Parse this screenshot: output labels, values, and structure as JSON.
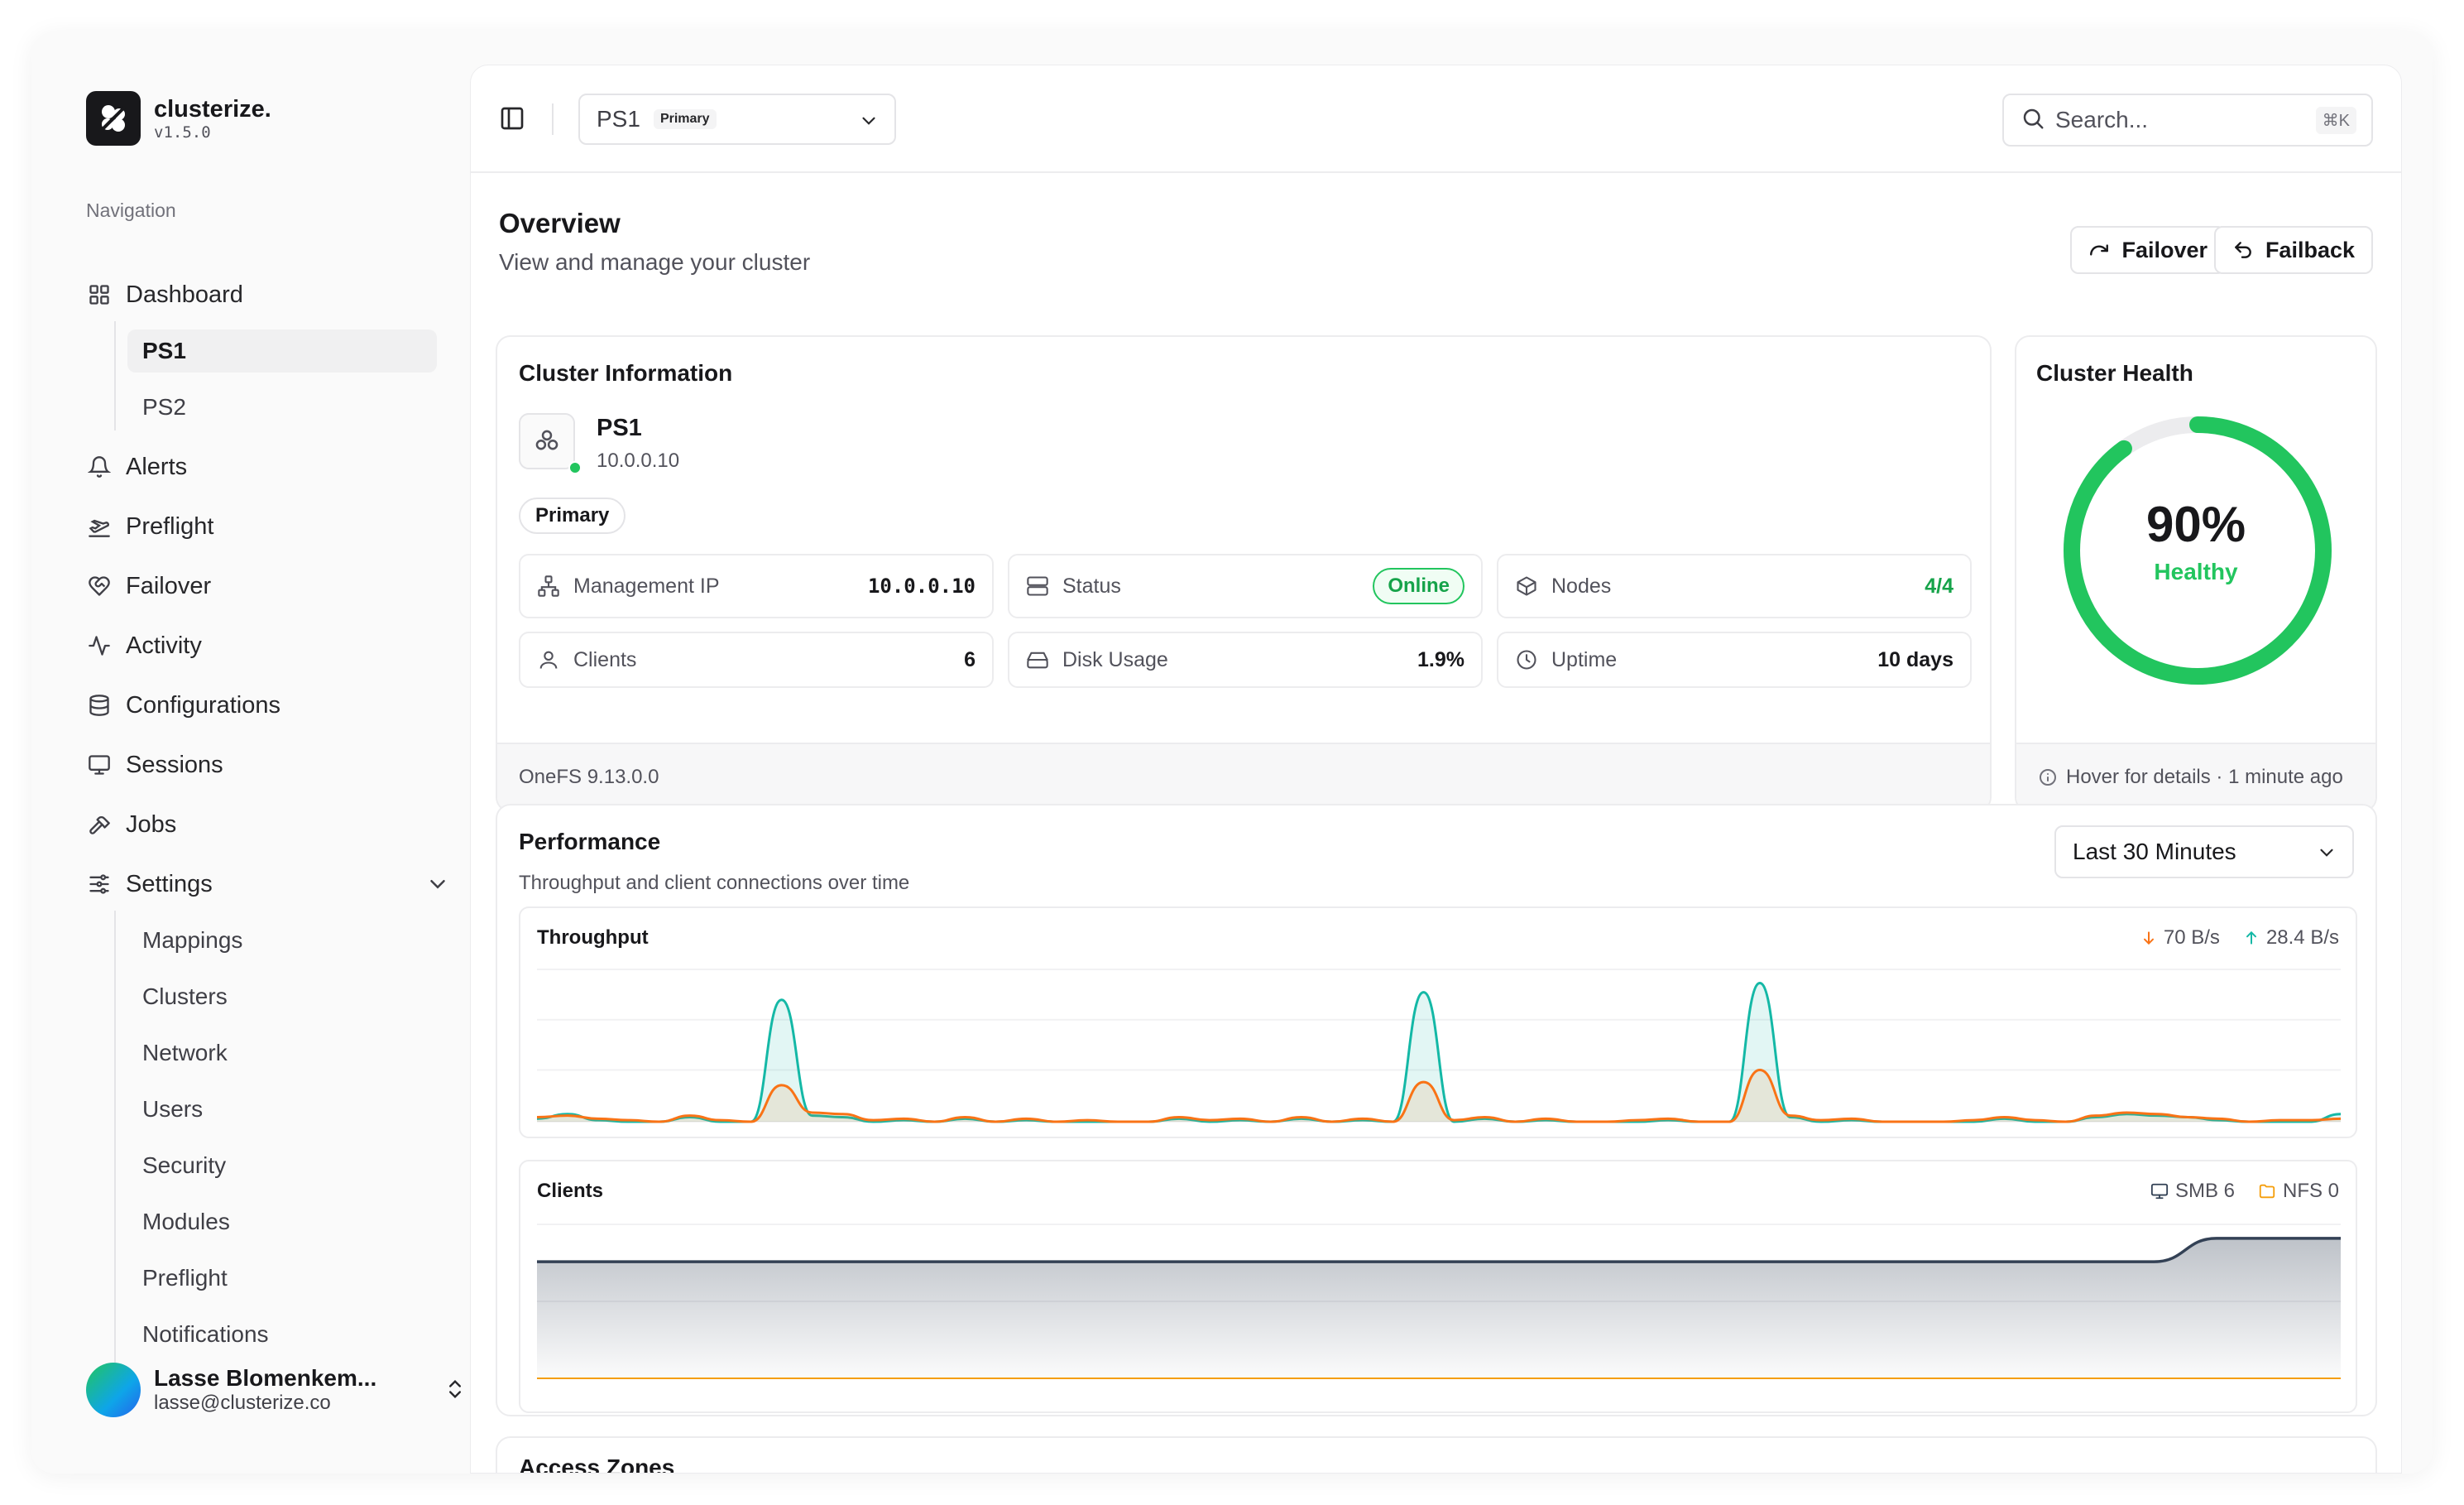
{
  "brand": {
    "name": "clusterize.",
    "version": "v1.5.0"
  },
  "sidebar": {
    "heading": "Navigation",
    "items": [
      {
        "label": "Dashboard",
        "icon": "layout-grid-icon"
      },
      {
        "label": "Alerts",
        "icon": "bell-icon"
      },
      {
        "label": "Preflight",
        "icon": "plane-takeoff-icon"
      },
      {
        "label": "Failover",
        "icon": "heart-handshake-icon"
      },
      {
        "label": "Activity",
        "icon": "activity-icon"
      },
      {
        "label": "Configurations",
        "icon": "database-icon"
      },
      {
        "label": "Sessions",
        "icon": "monitor-icon"
      },
      {
        "label": "Jobs",
        "icon": "hammer-icon"
      },
      {
        "label": "Settings",
        "icon": "sliders-icon"
      }
    ],
    "dashboard_children": [
      "PS1",
      "PS2"
    ],
    "settings_children": [
      "Mappings",
      "Clusters",
      "Network",
      "Users",
      "Security",
      "Modules",
      "Preflight",
      "Notifications"
    ]
  },
  "user": {
    "name": "Lasse Blomenkem...",
    "email": "lasse@clusterize.co"
  },
  "header": {
    "cluster_name": "PS1",
    "cluster_badge": "Primary",
    "search_placeholder": "Search...",
    "search_shortcut": "⌘K"
  },
  "overview": {
    "title": "Overview",
    "subtitle": "View and manage your cluster",
    "failover_label": "Failover",
    "failback_label": "Failback"
  },
  "cluster_info": {
    "title": "Cluster Information",
    "name": "PS1",
    "ip": "10.0.0.10",
    "role": "Primary",
    "stats": {
      "management_ip": {
        "label": "Management IP",
        "value": "10.0.0.10"
      },
      "status": {
        "label": "Status",
        "value": "Online"
      },
      "nodes": {
        "label": "Nodes",
        "value": "4/4"
      },
      "clients": {
        "label": "Clients",
        "value": "6"
      },
      "disk_usage": {
        "label": "Disk Usage",
        "value": "1.9%"
      },
      "uptime": {
        "label": "Uptime",
        "value": "10 days"
      }
    },
    "footer": "OneFS 9.13.0.0"
  },
  "cluster_health": {
    "title": "Cluster Health",
    "percent": 90,
    "percent_label": "90%",
    "status": "Healthy",
    "footer": "Hover for details · 1 minute ago",
    "color": "#22c55e"
  },
  "performance": {
    "title": "Performance",
    "subtitle": "Throughput and client connections over time",
    "range": "Last 30 Minutes",
    "throughput": {
      "title": "Throughput",
      "down_label": "70 B/s",
      "up_label": "28.4 B/s",
      "down_color": "#f97316",
      "up_color": "#14b8a6"
    },
    "clients": {
      "title": "Clients",
      "smb_label": "SMB 6",
      "nfs_label": "NFS 0",
      "smb_color": "#334155",
      "nfs_color": "#f59e0b"
    }
  },
  "chart_data": [
    {
      "type": "area",
      "title": "Throughput",
      "x": [
        0,
        1,
        2,
        3,
        4,
        5,
        6,
        7,
        8,
        9,
        10,
        11,
        12,
        13,
        14,
        15,
        16,
        17,
        18,
        19,
        20,
        21,
        22,
        23,
        24,
        25,
        26,
        27,
        28,
        29,
        30,
        31,
        32,
        33,
        34,
        35,
        36,
        37,
        38,
        39,
        40,
        41,
        42,
        43,
        44,
        45,
        46,
        47,
        48,
        49,
        50,
        51,
        52,
        53,
        54,
        55,
        56,
        57,
        58,
        59
      ],
      "series": [
        {
          "name": "70 B/s",
          "values": [
            3,
            4,
            2,
            1,
            0,
            4,
            1,
            0,
            24,
            6,
            5,
            1,
            2,
            0,
            3,
            0,
            2,
            0,
            1,
            0,
            0,
            3,
            1,
            2,
            0,
            3,
            0,
            2,
            0,
            26,
            1,
            3,
            0,
            2,
            0,
            0,
            1,
            2,
            0,
            0,
            34,
            4,
            1,
            2,
            0,
            0,
            0,
            1,
            3,
            1,
            0,
            4,
            6,
            5,
            3,
            2,
            0,
            1,
            1,
            2
          ]
        },
        {
          "name": "28.4 B/s",
          "values": [
            2,
            5,
            1,
            0,
            0,
            3,
            0,
            0,
            80,
            4,
            3,
            0,
            1,
            0,
            2,
            0,
            1,
            0,
            0,
            0,
            0,
            2,
            0,
            1,
            0,
            2,
            0,
            1,
            0,
            85,
            0,
            2,
            0,
            1,
            0,
            0,
            0,
            1,
            0,
            0,
            91,
            3,
            0,
            1,
            0,
            0,
            0,
            0,
            2,
            0,
            0,
            3,
            5,
            4,
            3,
            1,
            0,
            0,
            0,
            5
          ]
        }
      ]
    },
    {
      "type": "area",
      "title": "Clients",
      "x": [
        0,
        1,
        2,
        3,
        4,
        5,
        6,
        7,
        8,
        9,
        10,
        11,
        12,
        13,
        14,
        15,
        16,
        17,
        18,
        19,
        20,
        21,
        22,
        23,
        24,
        25,
        26,
        27,
        28,
        29
      ],
      "series": [
        {
          "name": "SMB 6",
          "values": [
            5,
            5,
            5,
            5,
            5,
            5,
            5,
            5,
            5,
            5,
            5,
            5,
            5,
            5,
            5,
            5,
            5,
            5,
            5,
            5,
            5,
            5,
            5,
            5,
            5,
            5,
            5,
            6,
            6,
            6
          ]
        },
        {
          "name": "NFS 0",
          "values": [
            0,
            0,
            0,
            0,
            0,
            0,
            0,
            0,
            0,
            0,
            0,
            0,
            0,
            0,
            0,
            0,
            0,
            0,
            0,
            0,
            0,
            0,
            0,
            0,
            0,
            0,
            0,
            0,
            0,
            0
          ]
        }
      ]
    }
  ],
  "next_section": {
    "title": "Access Zones"
  }
}
